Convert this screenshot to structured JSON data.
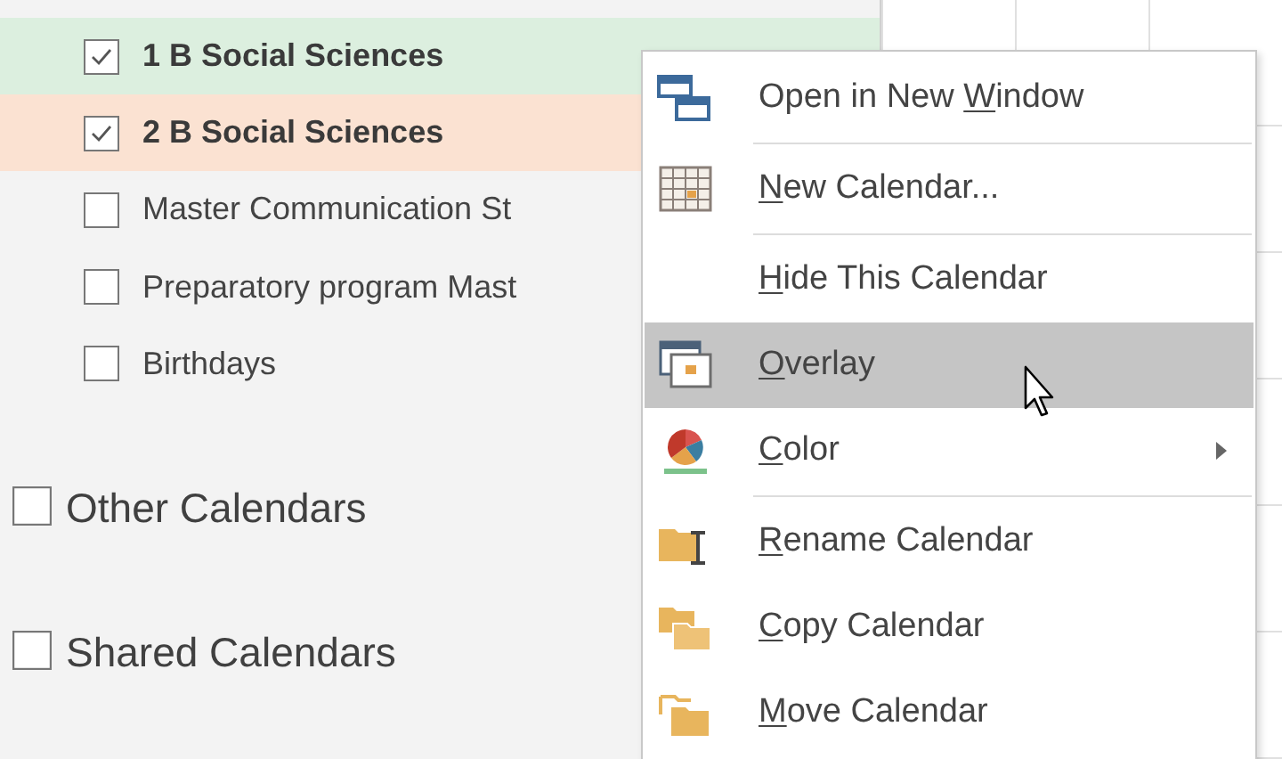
{
  "calendar_items": [
    {
      "label": "1 B Social Sciences",
      "checked": true,
      "color": "#dcefdf"
    },
    {
      "label": "2 B Social Sciences",
      "checked": true,
      "color": "#fbe2d2"
    },
    {
      "label": "Master Communication St",
      "checked": false
    },
    {
      "label": "Preparatory program Mast",
      "checked": false
    },
    {
      "label": "Birthdays",
      "checked": false
    }
  ],
  "calendar_groups": [
    {
      "label": "Other Calendars",
      "checked": false
    },
    {
      "label": "Shared Calendars",
      "checked": false
    }
  ],
  "context_menu": [
    {
      "kind": "item",
      "before": "Open in New ",
      "key": "W",
      "after": "indow",
      "selected": false,
      "submenu": false
    },
    {
      "kind": "separator"
    },
    {
      "kind": "item",
      "key": "N",
      "after": "ew Calendar...",
      "selected": false,
      "submenu": false
    },
    {
      "kind": "separator"
    },
    {
      "kind": "item",
      "key": "H",
      "after": "ide This Calendar",
      "selected": false,
      "submenu": false
    },
    {
      "kind": "item",
      "key": "O",
      "after": "verlay",
      "selected": true,
      "submenu": false
    },
    {
      "kind": "item",
      "key": "C",
      "after": "olor",
      "selected": false,
      "submenu": true
    },
    {
      "kind": "separator"
    },
    {
      "kind": "item",
      "key": "R",
      "after": "ename Calendar",
      "selected": false,
      "submenu": false
    },
    {
      "kind": "item",
      "key": "C",
      "after": "opy Calendar",
      "selected": false,
      "submenu": false
    },
    {
      "kind": "item",
      "key": "M",
      "after": "ove Calendar",
      "selected": false,
      "submenu": false
    }
  ]
}
